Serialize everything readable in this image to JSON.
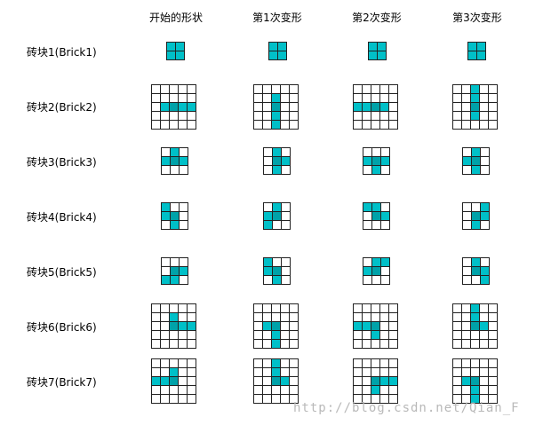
{
  "headers": [
    "开始的形状",
    "第1次变形",
    "第2次变形",
    "第3次变形"
  ],
  "rows": [
    {
      "label": "砖块1(Brick1)"
    },
    {
      "label": "砖块2(Brick2)"
    },
    {
      "label": "砖块3(Brick3)"
    },
    {
      "label": "砖块4(Brick4)"
    },
    {
      "label": "砖块5(Brick5)"
    },
    {
      "label": "砖块6(Brick6)"
    },
    {
      "label": "砖块7(Brick7)"
    }
  ],
  "colors": {
    "block": "#00c0c8",
    "pivot": "#00a2a9",
    "grid": "#222222"
  },
  "watermark": "http://blog.csdn.net/Qian_F"
}
